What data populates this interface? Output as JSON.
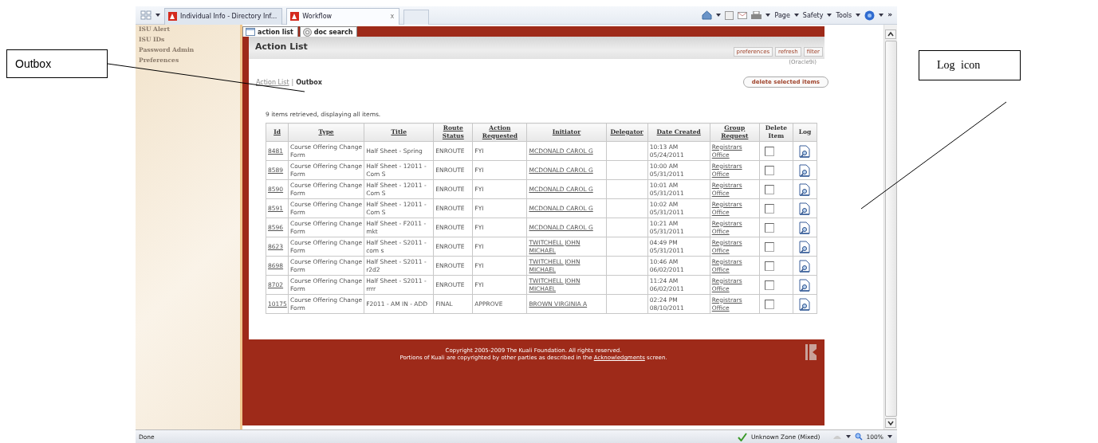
{
  "browser": {
    "tabs": [
      {
        "label": "Individual Info - Directory Inf...",
        "selected": false
      },
      {
        "label": "Workflow",
        "selected": true
      }
    ],
    "close_tab": "x",
    "command_bar": [
      "Page",
      "Safety",
      "Tools"
    ],
    "overflow": "»",
    "status_bar": {
      "text": "Done",
      "zone": "Unknown Zone (Mixed)",
      "zoom": "100%"
    }
  },
  "sidebar": {
    "items": [
      "ISU Alert",
      "ISU IDs",
      "Password Admin",
      "Preferences"
    ]
  },
  "app_tabs": [
    "action list",
    "doc search"
  ],
  "header": {
    "title": "Action List",
    "buttons": [
      "preferences",
      "refresh",
      "filter"
    ],
    "datasource": "(Oracle9i)"
  },
  "breadcrumb": {
    "link": "Action List",
    "separator": "|",
    "current": "Outbox"
  },
  "delete_button": "delete selected items",
  "summary": "9 items retrieved, displaying all items.",
  "table": {
    "columns": [
      "Id",
      "Type",
      "Title",
      "Route Status",
      "Action Requested",
      "Initiator",
      "Delegator",
      "Date Created",
      "Group Request",
      "Delete Item",
      "Log"
    ],
    "rows": [
      {
        "id": "8481",
        "type": "Course Offering Change Form",
        "title": "Half Sheet - Spring",
        "route_status": "ENROUTE",
        "action": "FYI",
        "initiator": "MCDONALD CAROL G",
        "date_created": "10:13 AM 05/24/2011",
        "group": "Registrars Office",
        "checked": false
      },
      {
        "id": "8589",
        "type": "Course Offering Change Form",
        "title": "Half Sheet - 12011 - Com S",
        "route_status": "ENROUTE",
        "action": "FYI",
        "initiator": "MCDONALD CAROL G",
        "date_created": "10:00 AM 05/31/2011",
        "group": "Registrars Office",
        "checked": false
      },
      {
        "id": "8590",
        "type": "Course Offering Change Form",
        "title": "Half Sheet - 12011 - Com S",
        "route_status": "ENROUTE",
        "action": "FYI",
        "initiator": "MCDONALD CAROL G",
        "date_created": "10:01 AM 05/31/2011",
        "group": "Registrars Office",
        "checked": false
      },
      {
        "id": "8591",
        "type": "Course Offering Change Form",
        "title": "Half Sheet - 12011 - Com S",
        "route_status": "ENROUTE",
        "action": "FYI",
        "initiator": "MCDONALD CAROL G",
        "date_created": "10:02 AM 05/31/2011",
        "group": "Registrars Office",
        "checked": false
      },
      {
        "id": "8596",
        "type": "Course Offering Change Form",
        "title": "Half Sheet - F2011 - mkt",
        "route_status": "ENROUTE",
        "action": "FYI",
        "initiator": "MCDONALD CAROL G",
        "date_created": "10:21 AM 05/31/2011",
        "group": "Registrars Office",
        "checked": false
      },
      {
        "id": "8623",
        "type": "Course Offering Change Form",
        "title": "Half Sheet - S2011 - com s",
        "route_status": "ENROUTE",
        "action": "FYI",
        "initiator": "TWITCHELL JOHN MICHAEL",
        "date_created": "04:49 PM 05/31/2011",
        "group": "Registrars Office",
        "checked": false
      },
      {
        "id": "8698",
        "type": "Course Offering Change Form",
        "title": "Half Sheet - S2011 - r2d2",
        "route_status": "ENROUTE",
        "action": "FYI",
        "initiator": "TWITCHELL JOHN MICHAEL",
        "date_created": "10:46 AM 06/02/2011",
        "group": "Registrars Office",
        "checked": false
      },
      {
        "id": "8702",
        "type": "Course Offering Change Form",
        "title": "Half Sheet - S2011 - rrrr",
        "route_status": "ENROUTE",
        "action": "FYI",
        "initiator": "TWITCHELL JOHN MICHAEL",
        "date_created": "11:24 AM 06/02/2011",
        "group": "Registrars Office",
        "checked": false
      },
      {
        "id": "10175",
        "type": "Course Offering Change Form",
        "title": "F2011 - AM IN - ADD",
        "route_status": "FINAL",
        "action": "APPROVE",
        "initiator": "BROWN VIRGINIA A",
        "date_created": "02:24 PM 08/10/2011",
        "group": "Registrars Office",
        "checked": false
      }
    ]
  },
  "footer": {
    "copyright": "Copyright 2005-2009 The Kuali Foundation. All rights reserved.",
    "portions": "Portions of Kuali are copyrighted by other parties as described in the",
    "link": "Acknowledgments",
    "after": "screen."
  },
  "annotations": [
    "Outbox",
    "Log icon"
  ]
}
